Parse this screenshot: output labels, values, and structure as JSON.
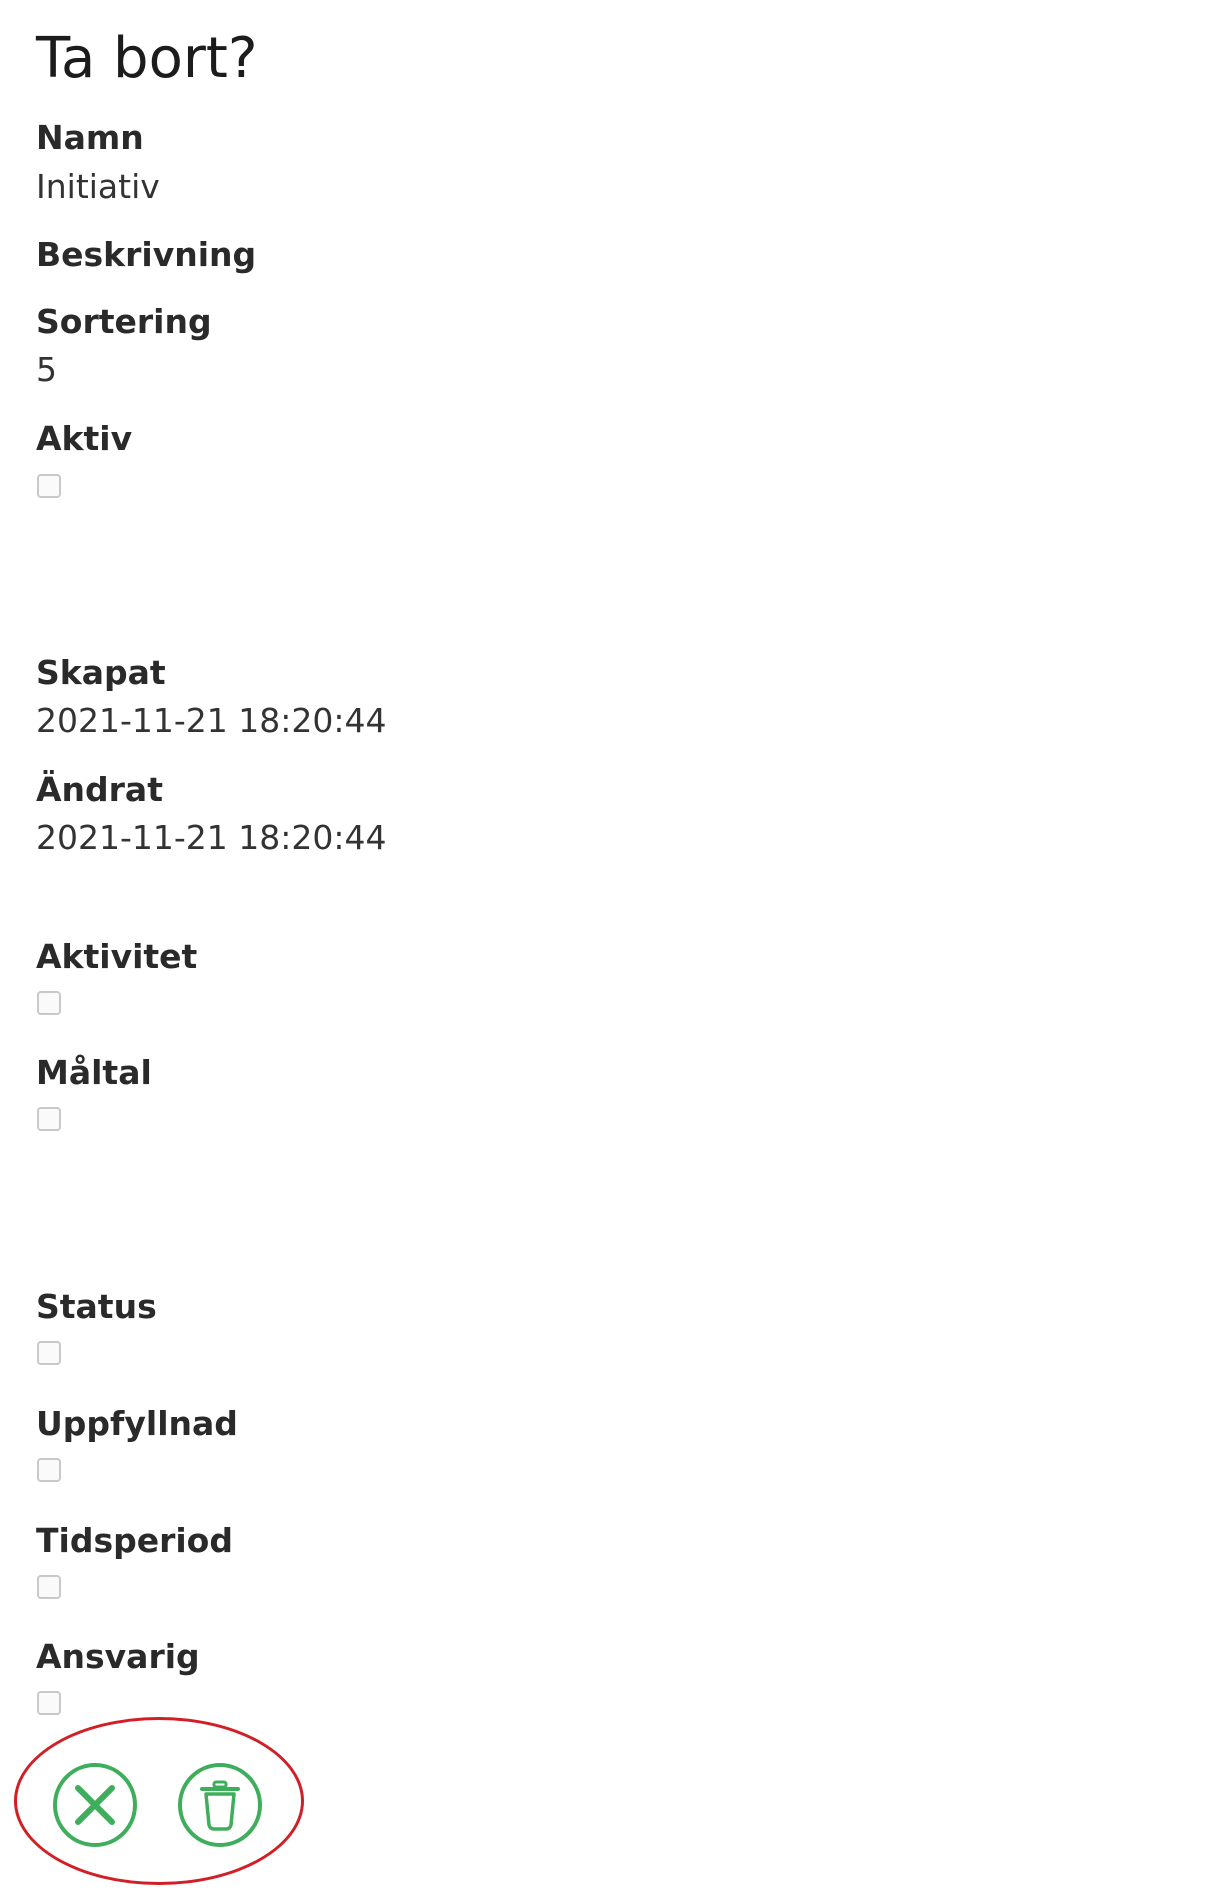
{
  "page": {
    "title": "Ta bort?"
  },
  "fields": {
    "namn": {
      "label": "Namn",
      "value": "Initiativ"
    },
    "beskrivning": {
      "label": "Beskrivning"
    },
    "sortering": {
      "label": "Sortering",
      "value": "5"
    },
    "aktiv": {
      "label": "Aktiv",
      "checked": false
    },
    "skapat": {
      "label": "Skapat",
      "value": "2021-11-21 18:20:44"
    },
    "andrat": {
      "label": "Ändrat",
      "value": "2021-11-21 18:20:44"
    },
    "aktivitet": {
      "label": "Aktivitet",
      "checked": false
    },
    "maltal": {
      "label": "Måltal",
      "checked": false
    },
    "status": {
      "label": "Status",
      "checked": false
    },
    "uppfyllnad": {
      "label": "Uppfyllnad",
      "checked": false
    },
    "tidsperiod": {
      "label": "Tidsperiod",
      "checked": false
    },
    "ansvarig": {
      "label": "Ansvarig",
      "checked": false
    }
  },
  "actions": {
    "cancel_icon": "close-circle-icon",
    "delete_icon": "trash-icon"
  },
  "colors": {
    "action_green": "#3fae5c",
    "highlight_red": "#d21f26",
    "checkbox_border": "#c9c9c9"
  }
}
